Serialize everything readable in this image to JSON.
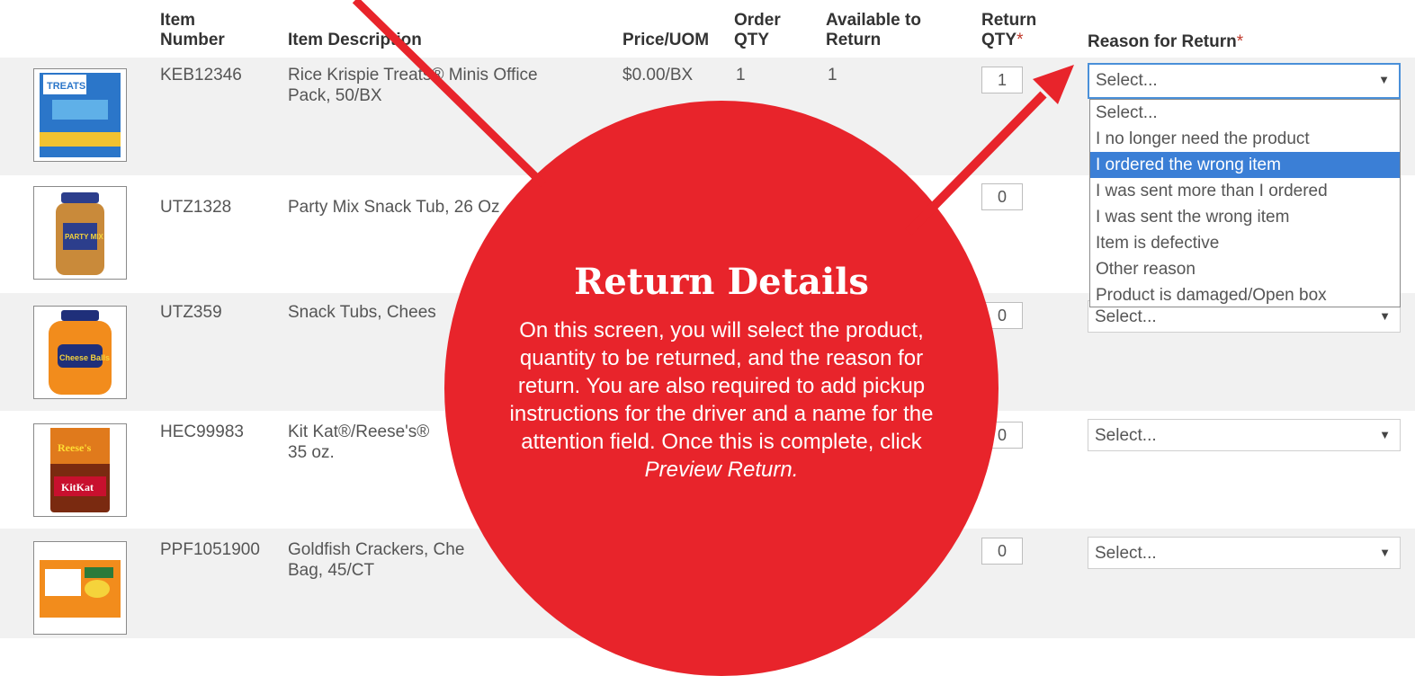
{
  "table": {
    "headers": {
      "item_number": [
        "Item",
        "Number"
      ],
      "item_description": "Item Description",
      "price_uom": "Price/UOM",
      "order_qty": [
        "Order",
        "QTY"
      ],
      "available": [
        "Available to",
        "Return"
      ],
      "return_qty": [
        "Return",
        "QTY"
      ],
      "reason": "Reason for Return",
      "required_mark": "*"
    },
    "rows": [
      {
        "item": "KEB12346",
        "desc": [
          "Rice Krispie Treats® Minis Office",
          "Pack, 50/BX"
        ],
        "price": "$0.00/BX",
        "order_qty": "1",
        "available": "1",
        "return_qty": "1",
        "reason": "Select..."
      },
      {
        "item": "UTZ1328",
        "desc": [
          "Party Mix Snack Tub, 26 Oz",
          ""
        ],
        "price": "",
        "order_qty": "",
        "available": "",
        "return_qty": "0",
        "reason": "Select..."
      },
      {
        "item": "UTZ359",
        "desc": [
          "Snack Tubs, Chees",
          ""
        ],
        "price": "",
        "order_qty": "",
        "available": "",
        "return_qty": "0",
        "reason": "Select..."
      },
      {
        "item": "HEC99983",
        "desc": [
          "Kit Kat®/Reese's®",
          "35 oz."
        ],
        "price": "",
        "order_qty": "",
        "available": "",
        "return_qty": "0",
        "reason": "Select..."
      },
      {
        "item": "PPF1051900",
        "desc": [
          "Goldfish Crackers, Che",
          "Bag, 45/CT"
        ],
        "price": "",
        "order_qty": "",
        "available": "",
        "return_qty": "0",
        "reason": "Select..."
      }
    ],
    "thumbnail_labels": [
      "TREATS",
      "PARTY MIX",
      "Cheese Balls",
      "Reese's",
      "KitKat"
    ]
  },
  "dropdown": {
    "options": [
      "Select...",
      "I no longer need the product",
      "I ordered the wrong item",
      "I was sent more than I ordered",
      "I was sent the wrong item",
      "Item is defective",
      "Other reason",
      "Product is damaged/Open box"
    ],
    "selected_index": 2
  },
  "callout": {
    "title": "Return Details",
    "body": "On this screen, you will select the product, quantity to be returned, and the reason for return. You are also required to add pickup instructions for the driver and a name for the attention field. Once this is complete, click ",
    "body_emphasis": "Preview Return."
  },
  "colors": {
    "callout_red": "#e8242b",
    "dropdown_highlight": "#3b7fd6",
    "row_shade": "#f1f1f1"
  },
  "icons": [
    "caret-down-icon",
    "arrow-pointer"
  ]
}
